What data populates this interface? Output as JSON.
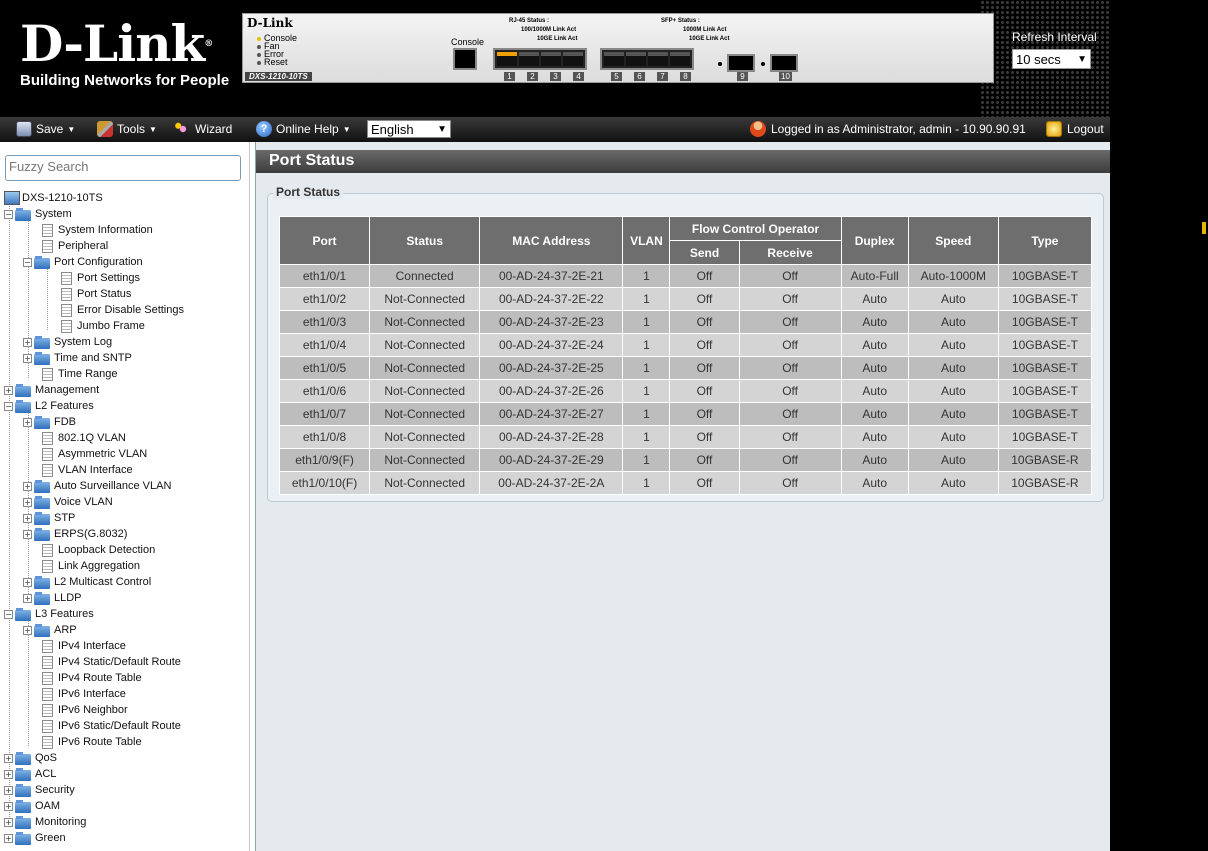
{
  "brand": {
    "logo_text": "D-Link",
    "registered": "®",
    "tagline": "Building Networks for People"
  },
  "device": {
    "brand": "D-Link",
    "model": "DXS-1210-10TS",
    "leds": [
      "Console",
      "Fan",
      "Error",
      "Reset"
    ],
    "console_label": "Console",
    "rj45_status": {
      "title": "RJ-45 Status :",
      "line1": "100/1000M Link  Act",
      "line2": "10GE Link  Act"
    },
    "sfp_status": {
      "title": "SFP+ Status :",
      "line1": "1000M Link  Act",
      "line2": "10GE Link  Act"
    },
    "port_numbers": [
      "1",
      "2",
      "3",
      "4",
      "5",
      "6",
      "7",
      "8",
      "9",
      "10"
    ]
  },
  "refresh": {
    "label": "Refresh Interval",
    "value": "10 secs"
  },
  "toolbar": {
    "save": "Save",
    "tools": "Tools",
    "wizard": "Wizard",
    "online_help": "Online Help",
    "language": "English",
    "login_info": "Logged in as Administrator, admin - 10.90.90.91",
    "logout": "Logout"
  },
  "sidebar": {
    "search_placeholder": "Fuzzy Search",
    "tree": [
      {
        "label": "DXS-1210-10TS"
      },
      {
        "label": "System"
      },
      {
        "label": "System Information"
      },
      {
        "label": "Peripheral"
      },
      {
        "label": "Port Configuration"
      },
      {
        "label": "Port Settings"
      },
      {
        "label": "Port Status"
      },
      {
        "label": "Error Disable Settings"
      },
      {
        "label": "Jumbo Frame"
      },
      {
        "label": "System Log"
      },
      {
        "label": "Time and SNTP"
      },
      {
        "label": "Time Range"
      },
      {
        "label": "Management"
      },
      {
        "label": "L2 Features"
      },
      {
        "label": "FDB"
      },
      {
        "label": "802.1Q VLAN"
      },
      {
        "label": "Asymmetric VLAN"
      },
      {
        "label": "VLAN Interface"
      },
      {
        "label": "Auto Surveillance VLAN"
      },
      {
        "label": "Voice VLAN"
      },
      {
        "label": "STP"
      },
      {
        "label": "ERPS(G.8032)"
      },
      {
        "label": "Loopback Detection"
      },
      {
        "label": "Link Aggregation"
      },
      {
        "label": "L2 Multicast Control"
      },
      {
        "label": "LLDP"
      },
      {
        "label": "L3 Features"
      },
      {
        "label": "ARP"
      },
      {
        "label": "IPv4 Interface"
      },
      {
        "label": "IPv4 Static/Default Route"
      },
      {
        "label": "IPv4 Route Table"
      },
      {
        "label": "IPv6 Interface"
      },
      {
        "label": "IPv6 Neighbor"
      },
      {
        "label": "IPv6 Static/Default Route"
      },
      {
        "label": "IPv6 Route Table"
      },
      {
        "label": "QoS"
      },
      {
        "label": "ACL"
      },
      {
        "label": "Security"
      },
      {
        "label": "OAM"
      },
      {
        "label": "Monitoring"
      },
      {
        "label": "Green"
      }
    ]
  },
  "main": {
    "title": "Port Status",
    "section_title": "Port Status",
    "table": {
      "headers": {
        "port": "Port",
        "status": "Status",
        "mac": "MAC Address",
        "vlan": "VLAN",
        "flow_control": "Flow Control Operator",
        "send": "Send",
        "receive": "Receive",
        "duplex": "Duplex",
        "speed": "Speed",
        "type": "Type"
      },
      "rows": [
        [
          "eth1/0/1",
          "Connected",
          "00-AD-24-37-2E-21",
          "1",
          "Off",
          "Off",
          "Auto-Full",
          "Auto-1000M",
          "10GBASE-T"
        ],
        [
          "eth1/0/2",
          "Not-Connected",
          "00-AD-24-37-2E-22",
          "1",
          "Off",
          "Off",
          "Auto",
          "Auto",
          "10GBASE-T"
        ],
        [
          "eth1/0/3",
          "Not-Connected",
          "00-AD-24-37-2E-23",
          "1",
          "Off",
          "Off",
          "Auto",
          "Auto",
          "10GBASE-T"
        ],
        [
          "eth1/0/4",
          "Not-Connected",
          "00-AD-24-37-2E-24",
          "1",
          "Off",
          "Off",
          "Auto",
          "Auto",
          "10GBASE-T"
        ],
        [
          "eth1/0/5",
          "Not-Connected",
          "00-AD-24-37-2E-25",
          "1",
          "Off",
          "Off",
          "Auto",
          "Auto",
          "10GBASE-T"
        ],
        [
          "eth1/0/6",
          "Not-Connected",
          "00-AD-24-37-2E-26",
          "1",
          "Off",
          "Off",
          "Auto",
          "Auto",
          "10GBASE-T"
        ],
        [
          "eth1/0/7",
          "Not-Connected",
          "00-AD-24-37-2E-27",
          "1",
          "Off",
          "Off",
          "Auto",
          "Auto",
          "10GBASE-T"
        ],
        [
          "eth1/0/8",
          "Not-Connected",
          "00-AD-24-37-2E-28",
          "1",
          "Off",
          "Off",
          "Auto",
          "Auto",
          "10GBASE-T"
        ],
        [
          "eth1/0/9(F)",
          "Not-Connected",
          "00-AD-24-37-2E-29",
          "1",
          "Off",
          "Off",
          "Auto",
          "Auto",
          "10GBASE-R"
        ],
        [
          "eth1/0/10(F)",
          "Not-Connected",
          "00-AD-24-37-2E-2A",
          "1",
          "Off",
          "Off",
          "Auto",
          "Auto",
          "10GBASE-R"
        ]
      ]
    }
  },
  "colors": {
    "header_bg": "#000000",
    "table_header": "#6e6e6e",
    "row_odd": "#bdbdbd",
    "row_even": "#d4d4d4",
    "main_bg": "#e4eaee"
  }
}
